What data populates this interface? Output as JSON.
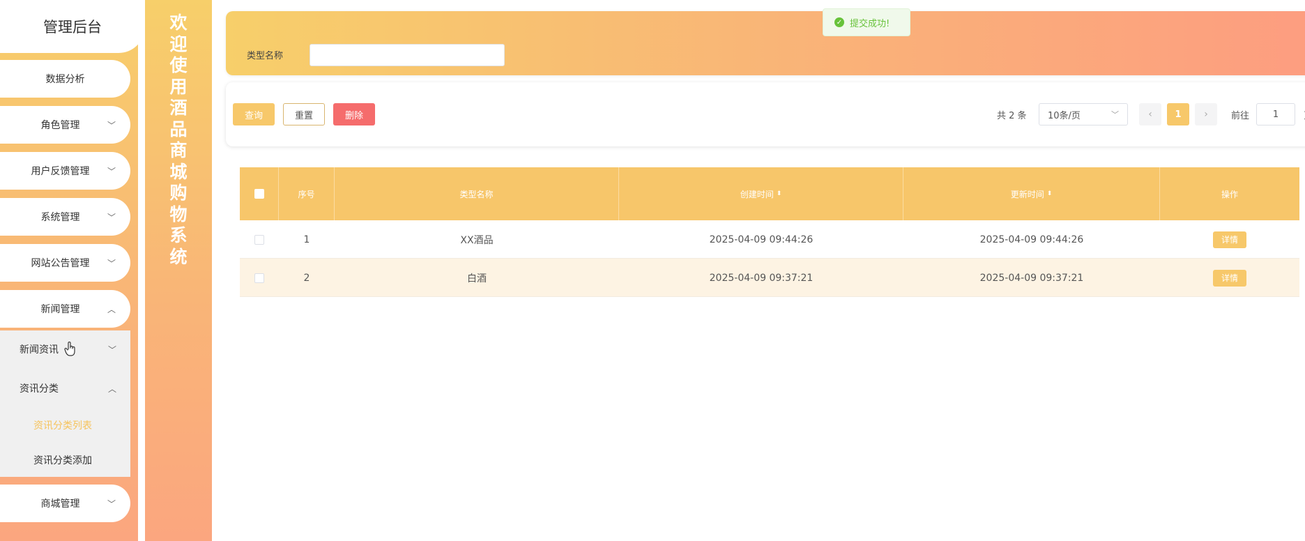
{
  "sidebar": {
    "title": "管理后台",
    "items": [
      {
        "label": "数据分析",
        "chevron": ""
      },
      {
        "label": "角色管理",
        "chevron": "﹀"
      },
      {
        "label": "用户反馈管理",
        "chevron": "﹀"
      },
      {
        "label": "系统管理",
        "chevron": "﹀"
      },
      {
        "label": "网站公告管理",
        "chevron": "﹀"
      },
      {
        "label": "新闻管理",
        "chevron": "︿"
      },
      {
        "label": "商城管理",
        "chevron": "﹀"
      }
    ],
    "sub": {
      "news_info": "新闻资讯",
      "news_cat": "资讯分类",
      "cat_list": "资讯分类列表",
      "cat_add": "资讯分类添加"
    }
  },
  "banner": "欢迎使用酒品商城购物系统",
  "toast": "提交成功!",
  "search": {
    "label": "类型名称",
    "value": ""
  },
  "toolbar": {
    "query": "查询",
    "reset": "重置",
    "delete": "删除"
  },
  "pager": {
    "total": "共 2 条",
    "size": "10条/页",
    "current": "1",
    "goto": "前往",
    "goto_value": "1",
    "page_suffix": "页",
    "prev": "‹",
    "next": "›"
  },
  "table": {
    "headers": [
      "序号",
      "类型名称",
      "创建时间",
      "更新时间",
      "操作"
    ],
    "rows": [
      {
        "idx": "1",
        "name": "XX酒品",
        "created": "2025-04-09 09:44:26",
        "updated": "2025-04-09 09:44:26",
        "action": "详情"
      },
      {
        "idx": "2",
        "name": "白酒",
        "created": "2025-04-09 09:37:21",
        "updated": "2025-04-09 09:37:21",
        "action": "详情"
      }
    ]
  },
  "colors": {
    "accent": "#f7c86a",
    "danger": "#f56c6c",
    "success": "#67c23a"
  }
}
